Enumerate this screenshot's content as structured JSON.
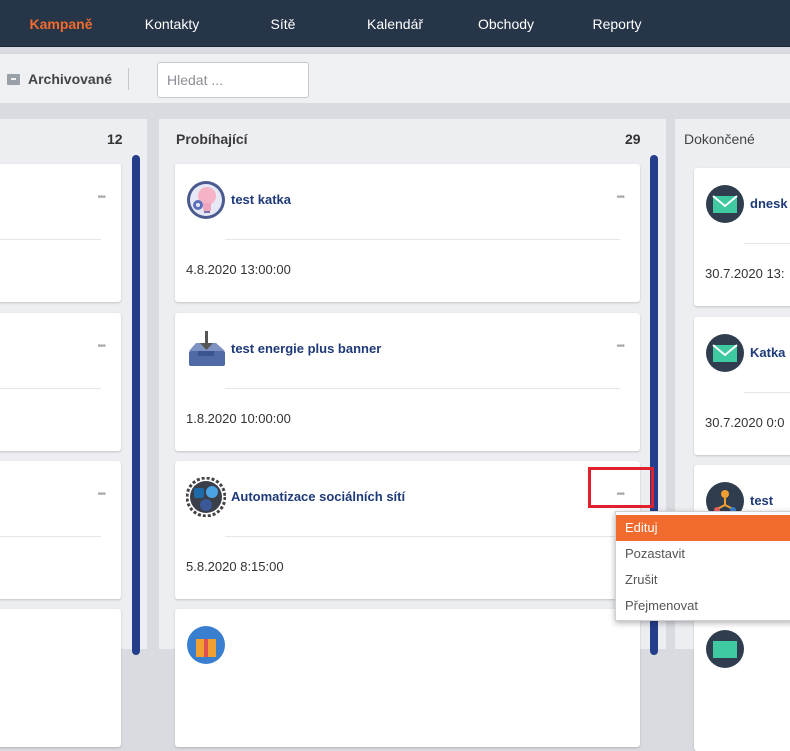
{
  "nav": {
    "items": [
      {
        "label": "Kampaně",
        "active": true
      },
      {
        "label": "Kontakty"
      },
      {
        "label": "Sítě"
      },
      {
        "label": "Kalendář"
      },
      {
        "label": "Obchody"
      },
      {
        "label": "Reporty"
      }
    ],
    "active_color": "#f26b2e",
    "background": "#263548"
  },
  "toolbar": {
    "archived_label": "Archivované",
    "archived_icon": "archive-box-icon",
    "search_placeholder": "Hledat ..."
  },
  "columns": [
    {
      "title": "",
      "count": "12",
      "cards": [
        {
          "title": "",
          "date": ""
        },
        {
          "title": "",
          "date": ""
        },
        {
          "title": "",
          "date": ""
        }
      ]
    },
    {
      "title": "Probíhající",
      "count": "29",
      "cards": [
        {
          "title": "test katka",
          "date": "4.8.2020 13:00:00",
          "icon": "lightbulb-gear-icon"
        },
        {
          "title": "test energie plus banner",
          "date": "1.8.2020 10:00:00",
          "icon": "inbox-download-icon"
        },
        {
          "title": "Automatizace sociálních sítí",
          "date": "5.8.2020 8:15:00",
          "icon": "social-gear-icon"
        },
        {
          "title": "",
          "icon": "gift-icon"
        }
      ]
    },
    {
      "title": "Dokončené",
      "count": "",
      "cards": [
        {
          "title": "dnesk",
          "date": "30.7.2020 13:",
          "icon": "envelope-icon"
        },
        {
          "title": "Katka",
          "date": "30.7.2020 0:0",
          "icon": "envelope-icon"
        },
        {
          "title": "test",
          "icon": "workflow-icon"
        },
        {
          "title": "",
          "icon": "envelope-icon"
        }
      ]
    }
  ],
  "card_menu": {
    "dots": "•••",
    "items": [
      "Edituj",
      "Pozastavit",
      "Zrušit",
      "Přejmenovat"
    ],
    "active_index": 0
  },
  "scrollbar_color": "#243e8c"
}
